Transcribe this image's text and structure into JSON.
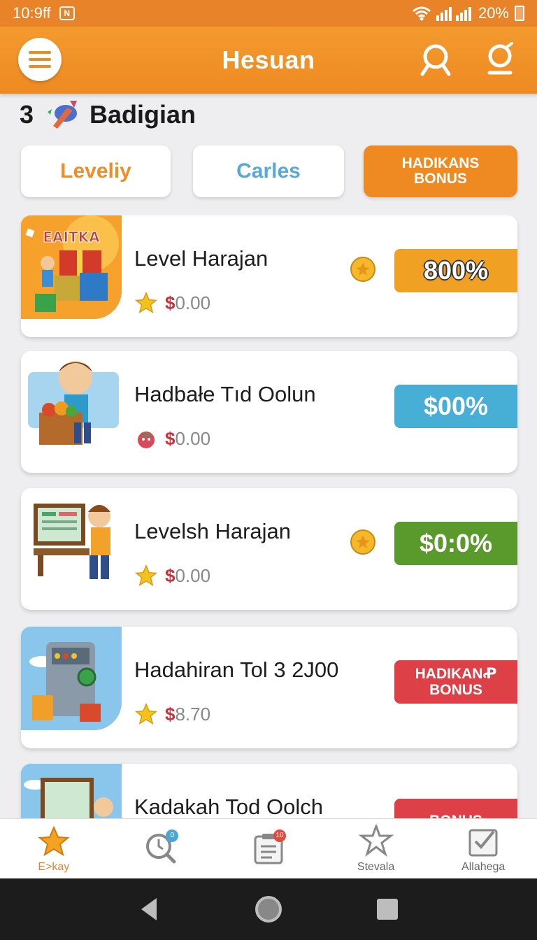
{
  "status_bar": {
    "time": "10:9ff",
    "notif_badge": "N",
    "battery": "20%"
  },
  "app_bar": {
    "title": "Hesuan"
  },
  "section": {
    "count": "3",
    "title": "Badigian"
  },
  "tabs": [
    {
      "label": "Leveliy"
    },
    {
      "label": "Carles"
    },
    {
      "label": "HADIKANS BONUS"
    }
  ],
  "cards": [
    {
      "title": "Level Harajan",
      "price_symbol": "$",
      "price_value": "0.00",
      "badge": "800%",
      "badge_color": "#f0a022",
      "thumb_text": "EAITKA"
    },
    {
      "title": "Hadbałe Tıd Oolun",
      "price_symbol": "$",
      "price_value": "0.00",
      "badge": "$00%",
      "badge_color": "#47aed6"
    },
    {
      "title": "Levelsh Harajan",
      "price_symbol": "$",
      "price_value": "0.00",
      "badge": "$0:0%",
      "badge_color": "#5a9a2c"
    },
    {
      "title": "Hadahiran Tol 3 2J00",
      "price_symbol": "$",
      "price_value": "8.70",
      "badge": "HADIKANꝒ BONUS",
      "badge_color": "#dd4046"
    },
    {
      "title": "Kadakah Tod Oolch",
      "badge": "BONUS",
      "badge_color": "#dd4046"
    }
  ],
  "bottom_nav": [
    {
      "label": "E>kay",
      "icon": "star-icon",
      "active": true
    },
    {
      "label": "",
      "icon": "magnifier-clock-icon",
      "dot": "0"
    },
    {
      "label": "",
      "icon": "clipboard-icon",
      "dot": "10"
    },
    {
      "label": "Stevala",
      "icon": "badge-star-icon"
    },
    {
      "label": "Allahega",
      "icon": "checklist-icon"
    }
  ],
  "colors": {
    "accent": "#ee8a22",
    "price": "#c8323a"
  }
}
